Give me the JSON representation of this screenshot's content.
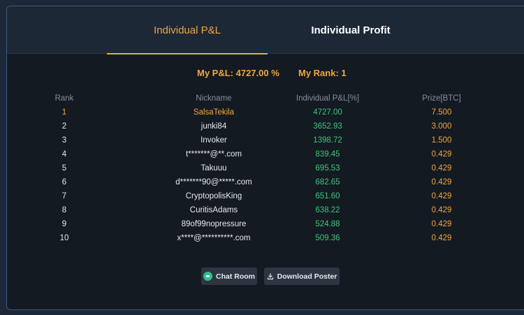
{
  "tabs": [
    {
      "label": "Individual P&L",
      "active": true
    },
    {
      "label": "Individual Profit",
      "active": false
    }
  ],
  "summary": {
    "my_pl": "My P&L: 4727.00 %",
    "my_rank": "My Rank: 1"
  },
  "table": {
    "headers": [
      "Rank",
      "Nickname",
      "Individual P&L[%]",
      "Prize[BTC]"
    ],
    "rows": [
      [
        "1",
        "SalsaTekila",
        "4727.00",
        "7.500"
      ],
      [
        "2",
        "junki84",
        "3652.93",
        "3.000"
      ],
      [
        "3",
        "Invoker",
        "1398.72",
        "1.500"
      ],
      [
        "4",
        "t*******@**.com",
        "839.45",
        "0.429"
      ],
      [
        "5",
        "Takuuu",
        "695.53",
        "0.429"
      ],
      [
        "6",
        "d*******90@*****.com",
        "682.65",
        "0.429"
      ],
      [
        "7",
        "CryptopolisKing",
        "651.60",
        "0.429"
      ],
      [
        "8",
        "CuritisAdams",
        "638.22",
        "0.429"
      ],
      [
        "9",
        "89of99nopressure",
        "524.88",
        "0.429"
      ],
      [
        "10",
        "x****@**********.com",
        "509.36",
        "0.429"
      ]
    ]
  },
  "buttons": {
    "chat_room": "Chat Room",
    "download_poster": "Download Poster"
  },
  "colors": {
    "accent": "#f0a640",
    "positive": "#3cc77a",
    "panel_border": "#3b5a7e"
  },
  "icons": {
    "chat": "chat-icon",
    "download": "download-icon"
  }
}
